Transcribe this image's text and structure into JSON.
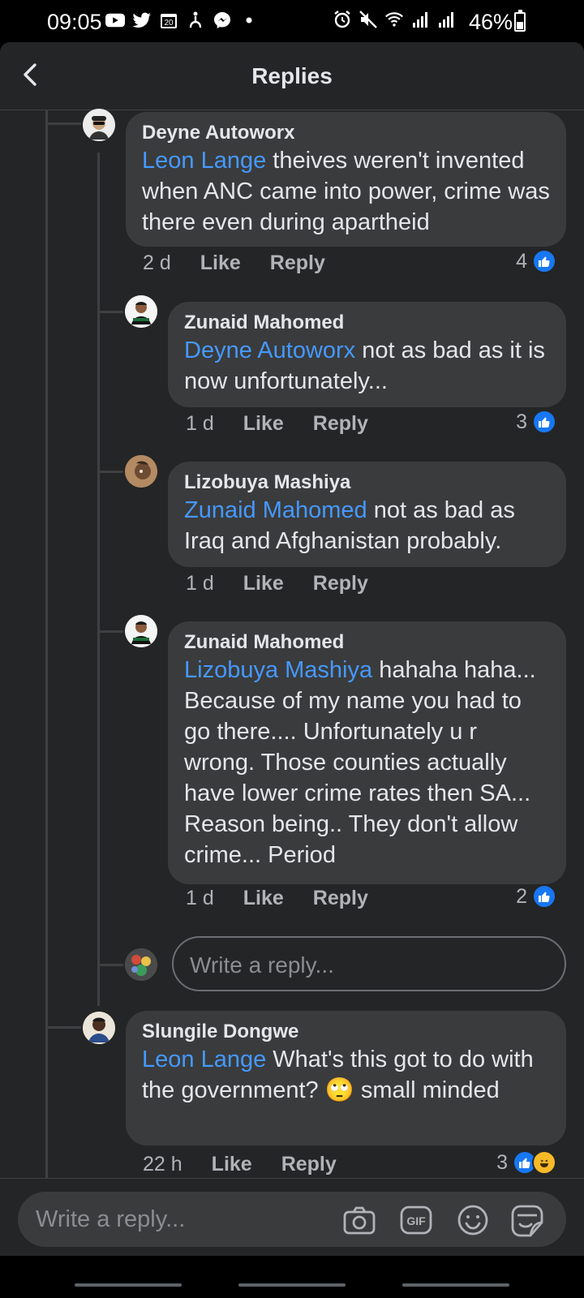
{
  "status_bar": {
    "time": "09:05",
    "calendar_day": "20",
    "battery": "46%",
    "left_icons": [
      "youtube-icon",
      "twitter-icon",
      "calendar-icon",
      "accessibility-icon",
      "messenger-icon",
      "dot-icon"
    ],
    "right_icons": [
      "alarm-icon",
      "mute-icon",
      "wifi-icon",
      "signal-icon",
      "signal-icon"
    ]
  },
  "header": {
    "title": "Replies"
  },
  "comments": [
    {
      "author": "Deyne Autoworx",
      "mention": "Leon Lange",
      "text": " theives weren't invented when ANC came into power, crime was there even during apartheid",
      "time": "2 d",
      "like": "Like",
      "reply": "Reply",
      "reactions": "4"
    },
    {
      "author": "Zunaid Mahomed",
      "mention": "Deyne Autoworx",
      "text": " not as bad as it is now unfortunately...",
      "time": "1 d",
      "like": "Like",
      "reply": "Reply",
      "reactions": "3"
    },
    {
      "author": "Lizobuya Mashiya",
      "mention": "Zunaid Mahomed",
      "text": " not as bad as Iraq and Afghanistan probably.",
      "time": "1 d",
      "like": "Like",
      "reply": "Reply",
      "reactions": ""
    },
    {
      "author": "Zunaid Mahomed",
      "mention": "Lizobuya Mashiya",
      "text": " hahaha haha... Because of my name you had to go there.... Unfortunately u r wrong. Those counties actually have lower crime rates then SA... Reason being.. They don't allow crime... Period",
      "time": "1 d",
      "like": "Like",
      "reply": "Reply",
      "reactions": "2"
    },
    {
      "author": "Slungile Dongwe",
      "mention": "Leon Lange",
      "text_before_emoji": " What's this got to do with the government? ",
      "emoji": "🙄",
      "text_after_emoji": " small minded",
      "time": "22 h",
      "like": "Like",
      "reply": "Reply",
      "reactions": "3"
    }
  ],
  "inline_reply_placeholder": "Write a reply...",
  "composer": {
    "placeholder": "Write a reply...",
    "icons": [
      "camera-icon",
      "gif-icon",
      "emoji-icon",
      "sticker-icon"
    ],
    "gif_label": "GIF"
  },
  "colors": {
    "background": "#242526",
    "bubble": "#3a3b3c",
    "mention": "#4599ff",
    "like_blue": "#1877f2"
  }
}
